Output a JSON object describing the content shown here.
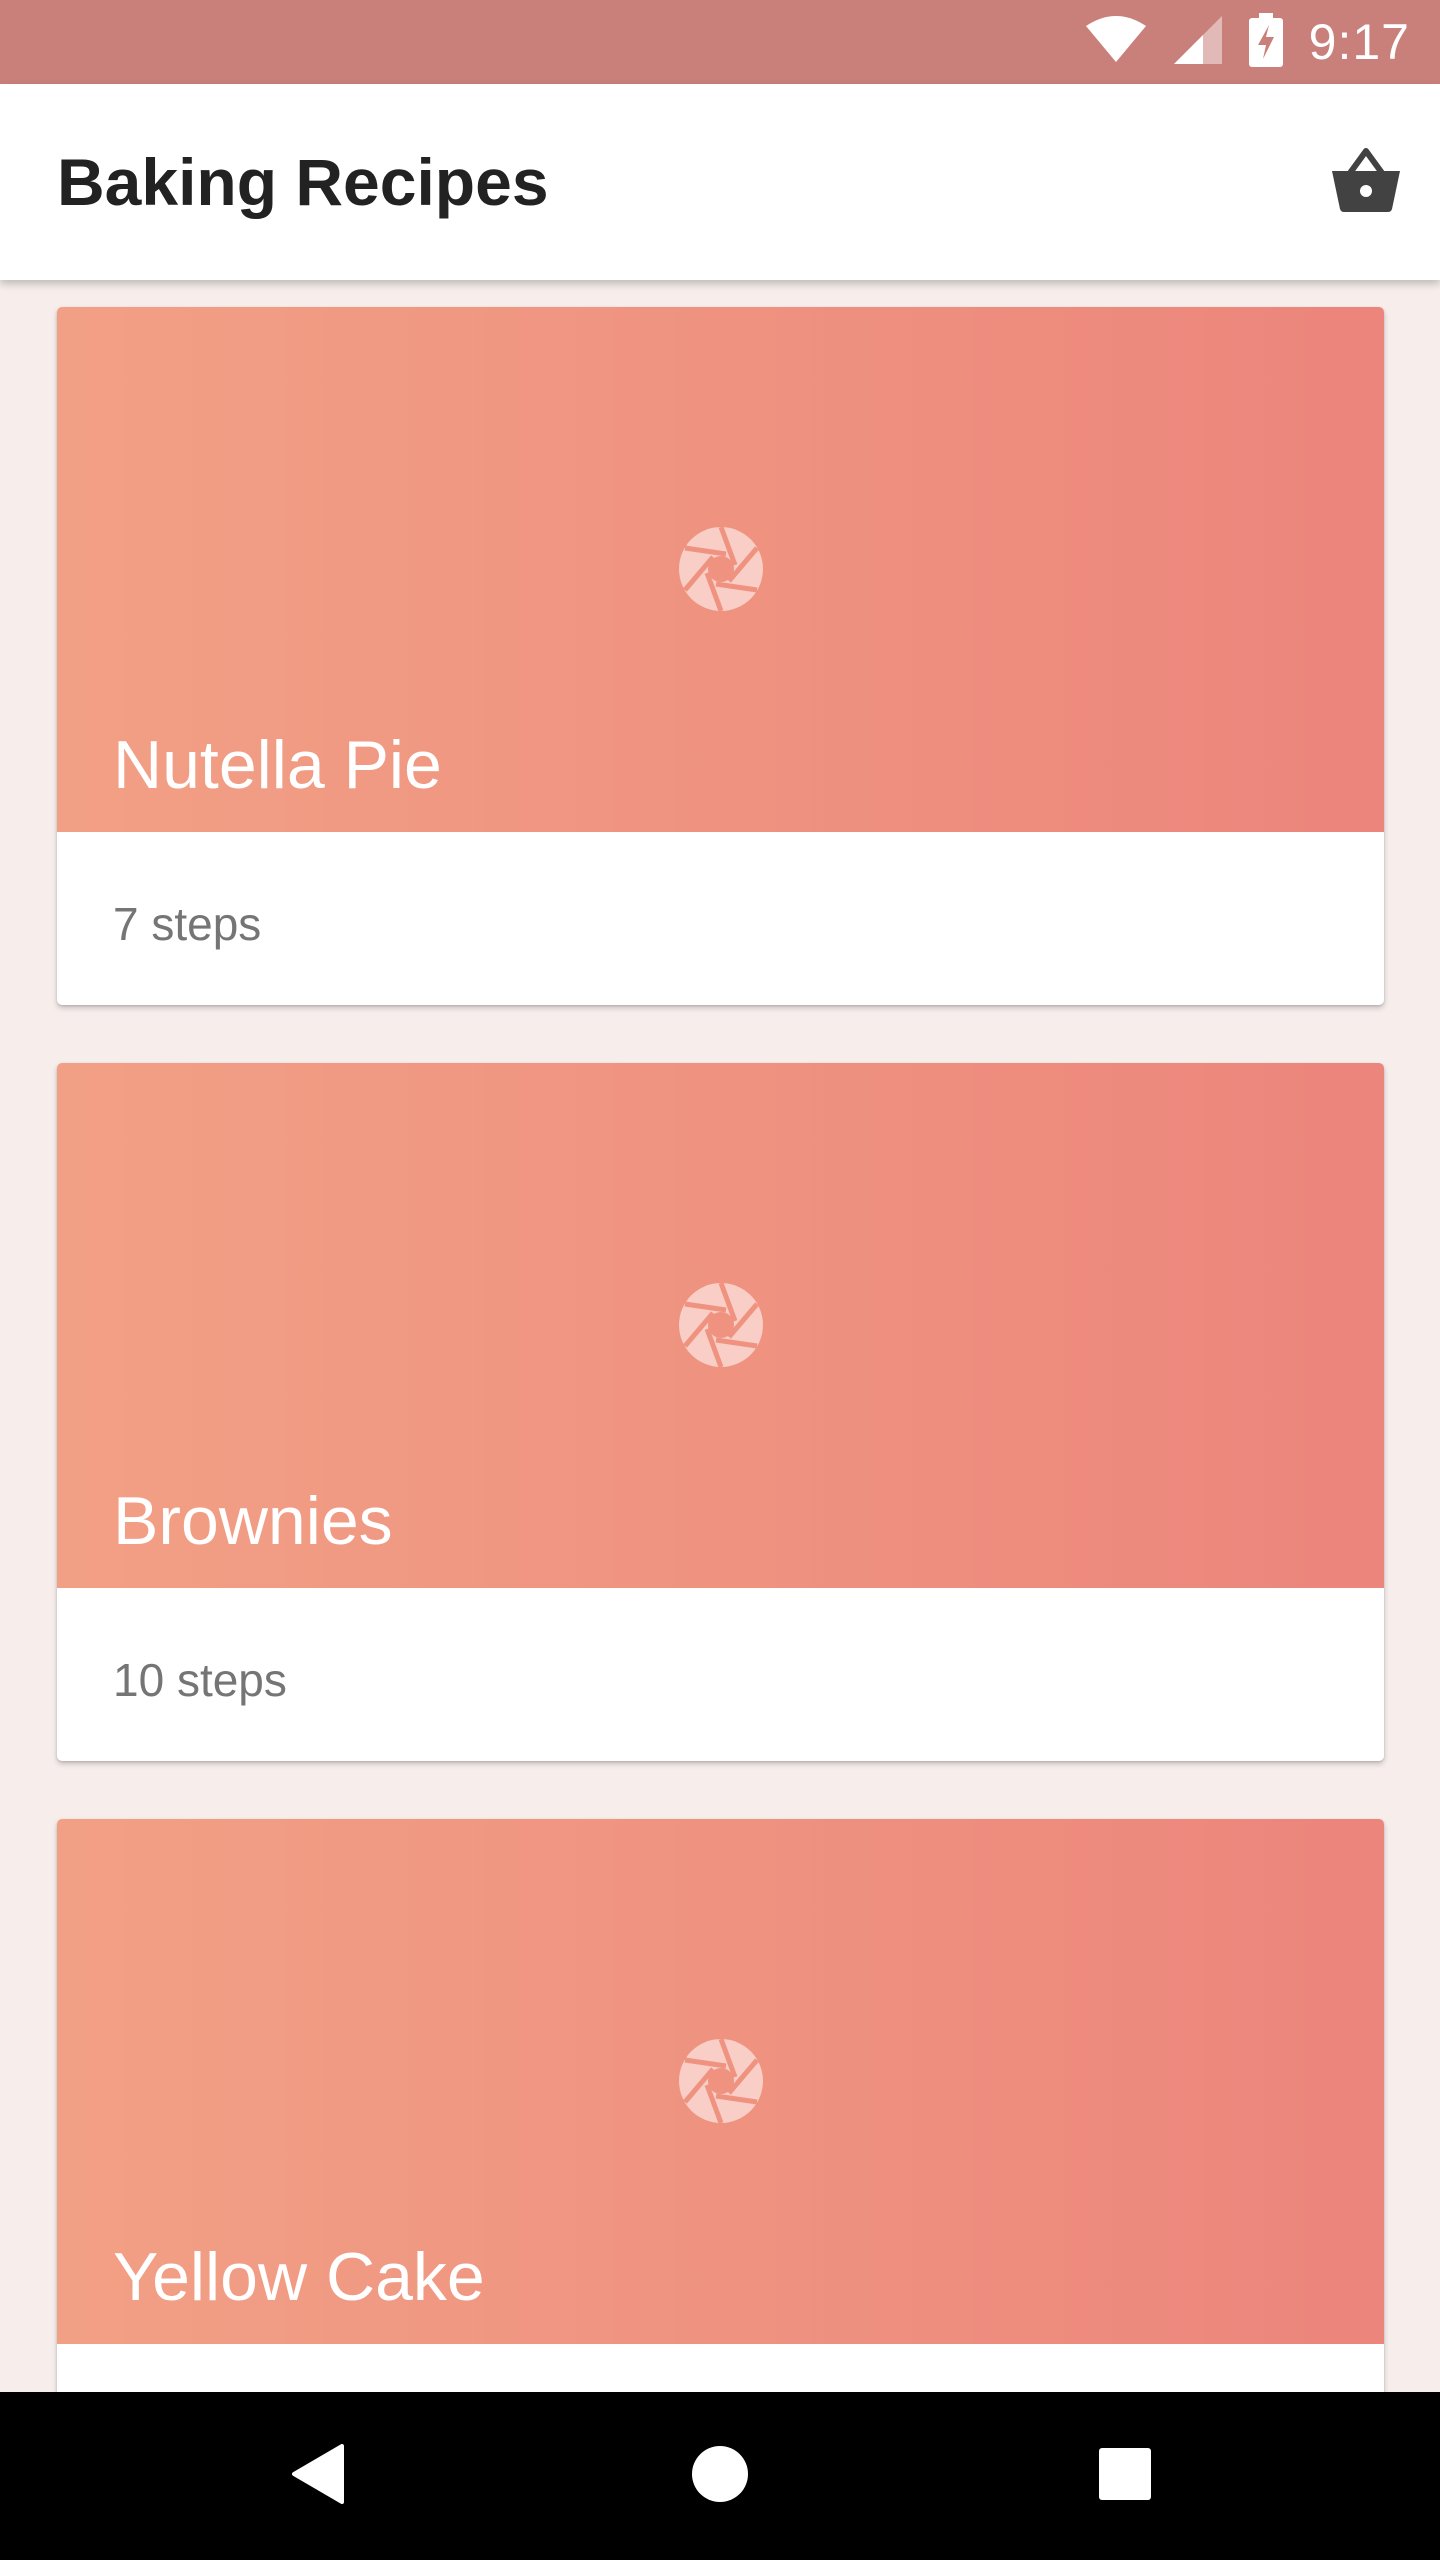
{
  "status_bar": {
    "time": "9:17",
    "icons": [
      "wifi-icon",
      "cell-signal-icon",
      "battery-charging-icon"
    ]
  },
  "app_bar": {
    "title": "Baking Recipes",
    "action_icon": "basket-icon"
  },
  "recipes": [
    {
      "name": "Nutella Pie",
      "steps": "7 steps"
    },
    {
      "name": "Brownies",
      "steps": "10 steps"
    },
    {
      "name": "Yellow Cake",
      "steps": ""
    }
  ],
  "card_placeholder_icon": "camera-aperture-icon",
  "nav_bar": {
    "icons": [
      "back-icon",
      "home-icon",
      "recents-icon"
    ]
  },
  "colors": {
    "status_bar": "#c9807a",
    "card_gradient_start": "#f2a085",
    "card_gradient_end": "#ec857c",
    "background": "#f7eeec"
  }
}
